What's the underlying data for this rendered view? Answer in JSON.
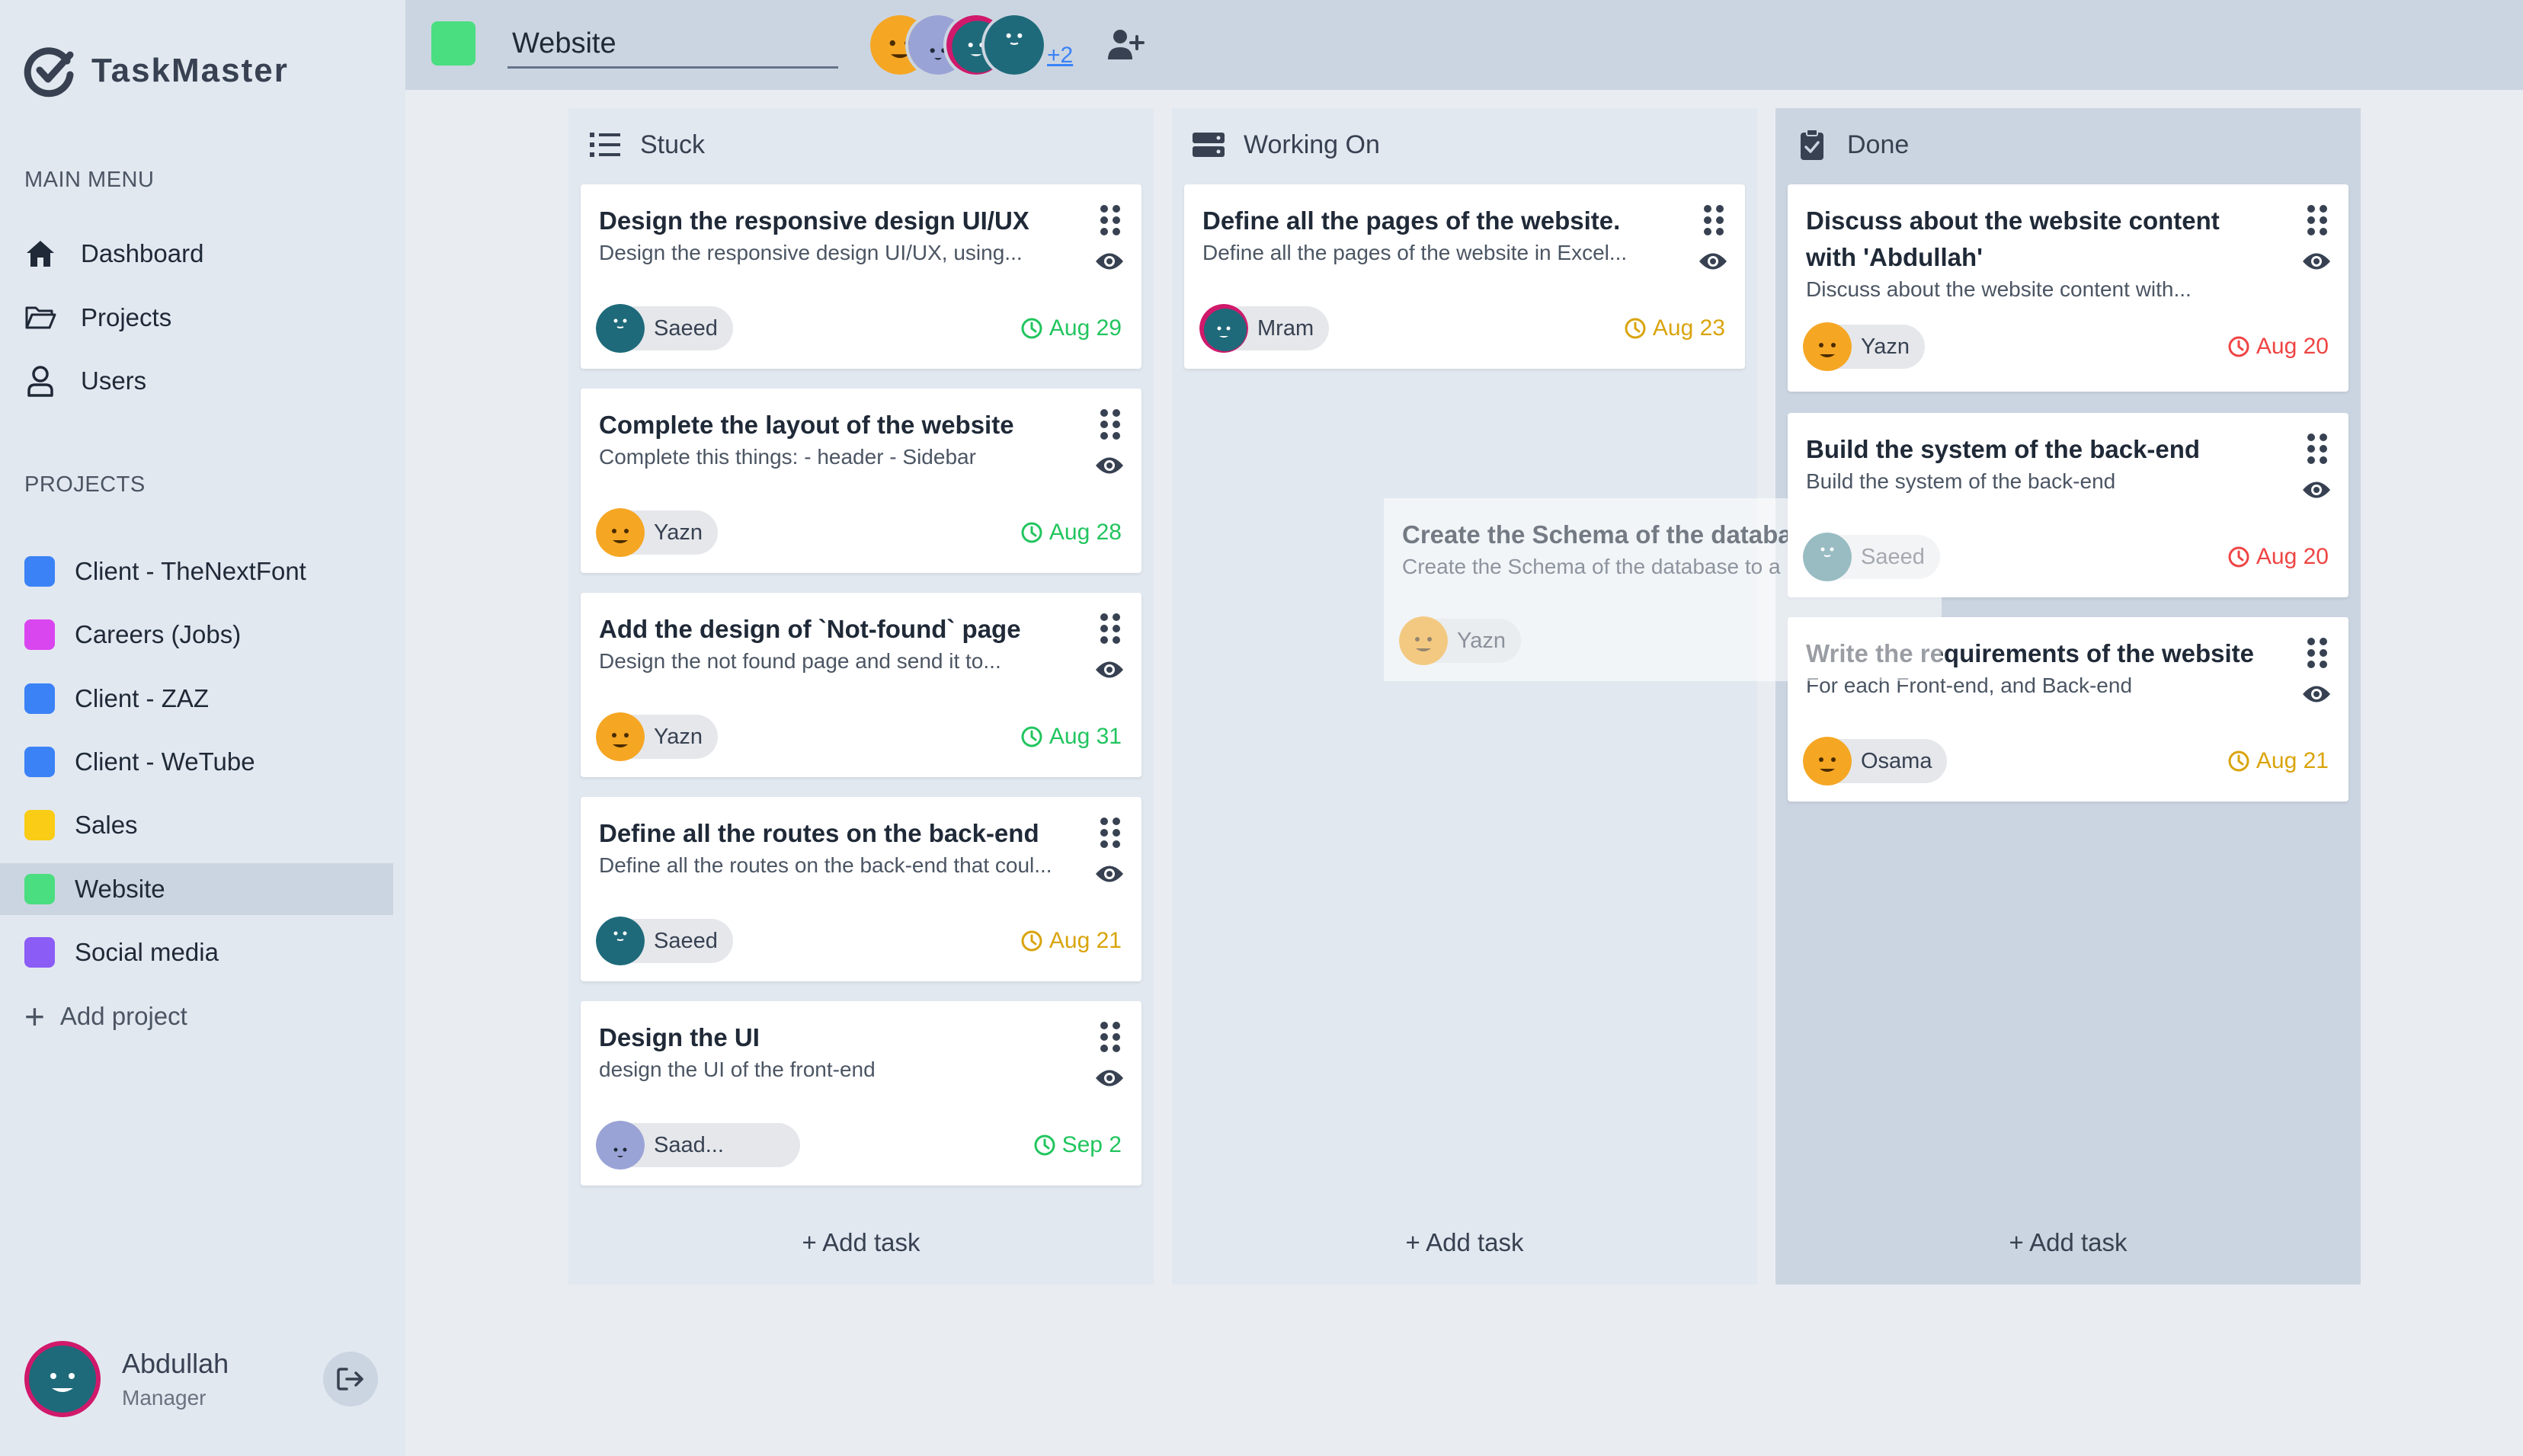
{
  "app": {
    "name": "TaskMaster"
  },
  "sidebar": {
    "main_menu_title": "MAIN MENU",
    "menu": [
      {
        "label": "Dashboard",
        "icon": "home-icon"
      },
      {
        "label": "Projects",
        "icon": "folder-icon"
      },
      {
        "label": "Users",
        "icon": "user-icon"
      }
    ],
    "projects_title": "PROJECTS",
    "projects": [
      {
        "label": "Client - TheNextFont",
        "color": "#3b82f6"
      },
      {
        "label": "Careers (Jobs)",
        "color": "#d946ef"
      },
      {
        "label": "Client - ZAZ",
        "color": "#3b82f6"
      },
      {
        "label": "Client - WeTube",
        "color": "#3b82f6"
      },
      {
        "label": "Sales",
        "color": "#facc15"
      },
      {
        "label": "Website",
        "color": "#4ade80",
        "active": true
      },
      {
        "label": "Social media",
        "color": "#8b5cf6"
      }
    ],
    "add_project": "Add project",
    "user": {
      "name": "Abdullah",
      "role": "Manager"
    }
  },
  "header": {
    "project_name": "Website",
    "project_color": "#4ade80",
    "more_members": "+2"
  },
  "columns": [
    {
      "title": "Stuck",
      "icon": "list-icon",
      "add_task": "+ Add task",
      "cards": [
        {
          "title": "Design the responsive design UI/UX",
          "desc": "Design the responsive design UI/UX, using...",
          "assignee": "Saeed",
          "due": "Aug 29",
          "due_status": "green"
        },
        {
          "title": "Complete the layout of the website",
          "desc": "Complete this things: - header - Sidebar",
          "assignee": "Yazn",
          "due": "Aug 28",
          "due_status": "green"
        },
        {
          "title": "Add the design of `Not-found` page",
          "desc": "Design the not found page and send it to...",
          "assignee": "Yazn",
          "due": "Aug 31",
          "due_status": "green"
        },
        {
          "title": "Define all the routes on the back-end",
          "desc": "Define all the routes on the back-end that coul...",
          "assignee": "Saeed",
          "due": "Aug 21",
          "due_status": "amber"
        },
        {
          "title": "Design the UI",
          "desc": "design the UI of the front-end",
          "assignee": "Saad...",
          "due": "Sep 2",
          "due_status": "green"
        }
      ]
    },
    {
      "title": "Working On",
      "icon": "server-icon",
      "add_task": "+ Add task",
      "cards": [
        {
          "title": "Define all the pages of the website.",
          "desc": "Define all the pages of the website in Excel...",
          "assignee": "Mram",
          "due": "Aug 23",
          "due_status": "amber"
        }
      ]
    },
    {
      "title": "Done",
      "icon": "clipboard-check-icon",
      "add_task": "+ Add task",
      "cards": [
        {
          "title": "Discuss about the website content with 'Abdullah'",
          "desc": "Discuss about the website content with...",
          "assignee": "Yazn",
          "due": "Aug 20",
          "due_status": "red"
        },
        {
          "title": "Build the system of the back-end",
          "desc": "Build the system of the back-end",
          "assignee": "Saeed",
          "due": "Aug 20",
          "due_status": "red"
        },
        {
          "title": "Write the requirements of the website",
          "desc": "For each Front-end, and Back-end",
          "assignee": "Osama",
          "due": "Aug 21",
          "due_status": "amber"
        }
      ]
    }
  ],
  "dragging_card": {
    "title": "Create the Schema of the databas",
    "desc": "Create the Schema of the database to a",
    "assignee": "Yazn"
  },
  "colors": {
    "green": "#22c55e",
    "amber": "#d9a40c",
    "red": "#ef4444",
    "teal_avatar": "#1e6a7a",
    "orange_avatar": "#f5a623",
    "purple_avatar": "#9aa3d6"
  }
}
